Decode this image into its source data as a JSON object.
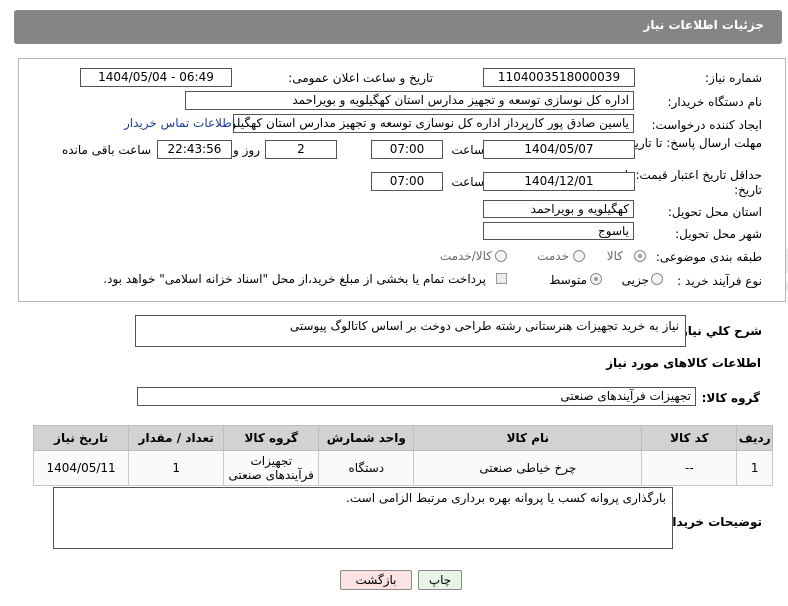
{
  "header": {
    "title": "جزئیات اطلاعات نیاز"
  },
  "labels": {
    "need_number": "شماره نیاز:",
    "announce_datetime": "تاریخ و ساعت اعلان عمومی:",
    "buyer_org": "نام دستگاه خریدار:",
    "requester": "ایجاد کننده درخواست:",
    "reply_deadline": "مهلت ارسال پاسخ: تا تاریخ:",
    "hour": "ساعت",
    "day_and": "روز و",
    "hours_remaining": "ساعت باقی مانده",
    "price_validity": "حداقل تاریخ اعتبار قیمت: تا تاریخ:",
    "delivery_province": "استان محل تحویل:",
    "delivery_city": "شهر محل تحویل:",
    "subject_category": "طبقه بندی موضوعی:",
    "process_type": "نوع فرآیند خرید :",
    "need_description": "شرح كلي نياز:",
    "goods_info": "اطلاعات کالاهای مورد نیاز",
    "goods_group": "گروه کالا:",
    "buyer_notes": "توضیحات خریدار:"
  },
  "fields": {
    "need_number": "1104003518000039",
    "announce_datetime": "1404/05/04 - 06:49",
    "buyer_org": "اداره کل نوسازی  توسعه و تجهیز مدارس استان کهگیلویه و بویراحمد",
    "requester": "یاسین صادق پور کارپرداز اداره کل نوسازی  توسعه و تجهیز مدارس استان کهگیلویه و بویراحمد",
    "contact_link": "اطلاعات تماس خریدار",
    "reply_date": "1404/05/07",
    "reply_time": "07:00",
    "reply_days": "2",
    "reply_remaining": "22:43:56",
    "validity_date": "1404/12/01",
    "validity_time": "07:00",
    "delivery_province": "کهگیلویه و بویراحمد",
    "delivery_city": "یاسوج",
    "need_description": "نیاز به خرید تجهیزات هنرستانی رشته طراحی دوخت بر اساس کاتالوگ پیوستی",
    "goods_group": "تجهیزات فرآیندهای صنعتی",
    "buyer_notes": "بارگذاری پروانه کسب یا پروانه بهره برداری مرتبط الزامی است."
  },
  "category_options": [
    {
      "label": "کالا",
      "selected": true
    },
    {
      "label": "خدمت",
      "selected": false
    },
    {
      "label": "کالا/خدمت",
      "selected": false
    }
  ],
  "process_options": [
    {
      "label": "جزیی",
      "selected": false
    },
    {
      "label": "متوسط",
      "selected": true
    }
  ],
  "payment_note": "پرداخت تمام یا بخشی از مبلغ خرید،از محل \"اسناد خزانه اسلامی\" خواهد بود.",
  "table": {
    "headers": [
      "ردیف",
      "کد کالا",
      "نام کالا",
      "واحد شمارش",
      "گروه کالا",
      "تعداد / مقدار",
      "تاریخ نیاز"
    ],
    "rows": [
      [
        "1",
        "--",
        "چرخ خیاطی صنعتی",
        "دستگاه",
        "تجهیزات فرآیندهای صنعتی",
        "1",
        "1404/05/11"
      ]
    ]
  },
  "buttons": {
    "print": "چاپ",
    "back": "بازگشت"
  },
  "watermark": "AriaTender.net",
  "colors": {
    "header_bg": "#858585",
    "table_header_bg": "#d2d2d2",
    "print_btn_bg": "#e6f5e6",
    "back_btn_bg": "#fbe3e3"
  }
}
